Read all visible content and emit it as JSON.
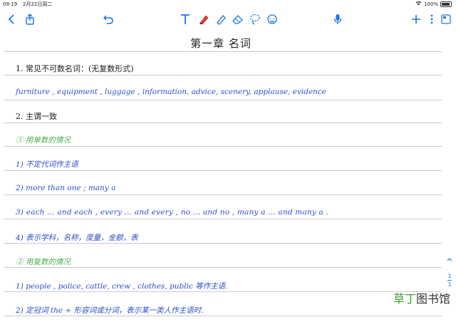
{
  "status_bar": {
    "time": "09:19",
    "date": "2月22日周二",
    "battery": "100%"
  },
  "toolbar": {
    "back_icon": "chevron-left-icon",
    "share_icon": "share-icon",
    "undo_icon": "undo-icon",
    "text_tool_icon": "text-tool-icon",
    "pen_icon": "pen-icon",
    "highlighter_icon": "highlighter-icon",
    "eraser_icon": "eraser-icon",
    "lasso_icon": "lasso-icon",
    "sticker_icon": "sticker-icon",
    "mic_icon": "microphone-icon",
    "add_icon": "plus-icon",
    "more_icon": "more-vertical-icon",
    "pages_icon": "pages-icon"
  },
  "note": {
    "title": "第一章 名词",
    "lines": [
      {
        "text": "1. 常见不可数名词：(无复数形式)",
        "color": "black"
      },
      {
        "text": "furniture , equipment , luggage , information, advice, scenery, applause, evidence",
        "color": "blue"
      },
      {
        "text": "2. 主谓一致",
        "color": "black"
      },
      {
        "text": "① 用单数的情况",
        "color": "green"
      },
      {
        "text": "1) 不定代词作主语",
        "color": "blue"
      },
      {
        "text": "2) more than one ; many a",
        "color": "blue"
      },
      {
        "text": "3) each … and each , every … and every , no … and no , many a … and many a .",
        "color": "blue"
      },
      {
        "text": "4) 表示学科，名称，度量，金额，表",
        "color": "blue"
      },
      {
        "text": "② 用复数的情况",
        "color": "green"
      },
      {
        "text": "1) people , police, cattle, crew , clothes, public 等作主语.",
        "color": "blue"
      },
      {
        "text": "2) 定冠词 the + 形容词或分词，表示某一类人作主语时.",
        "color": "blue"
      }
    ]
  },
  "page_indicator": {
    "current": "1",
    "total": "1"
  },
  "watermark": {
    "green": "草丁",
    "dark": "图书馆"
  }
}
